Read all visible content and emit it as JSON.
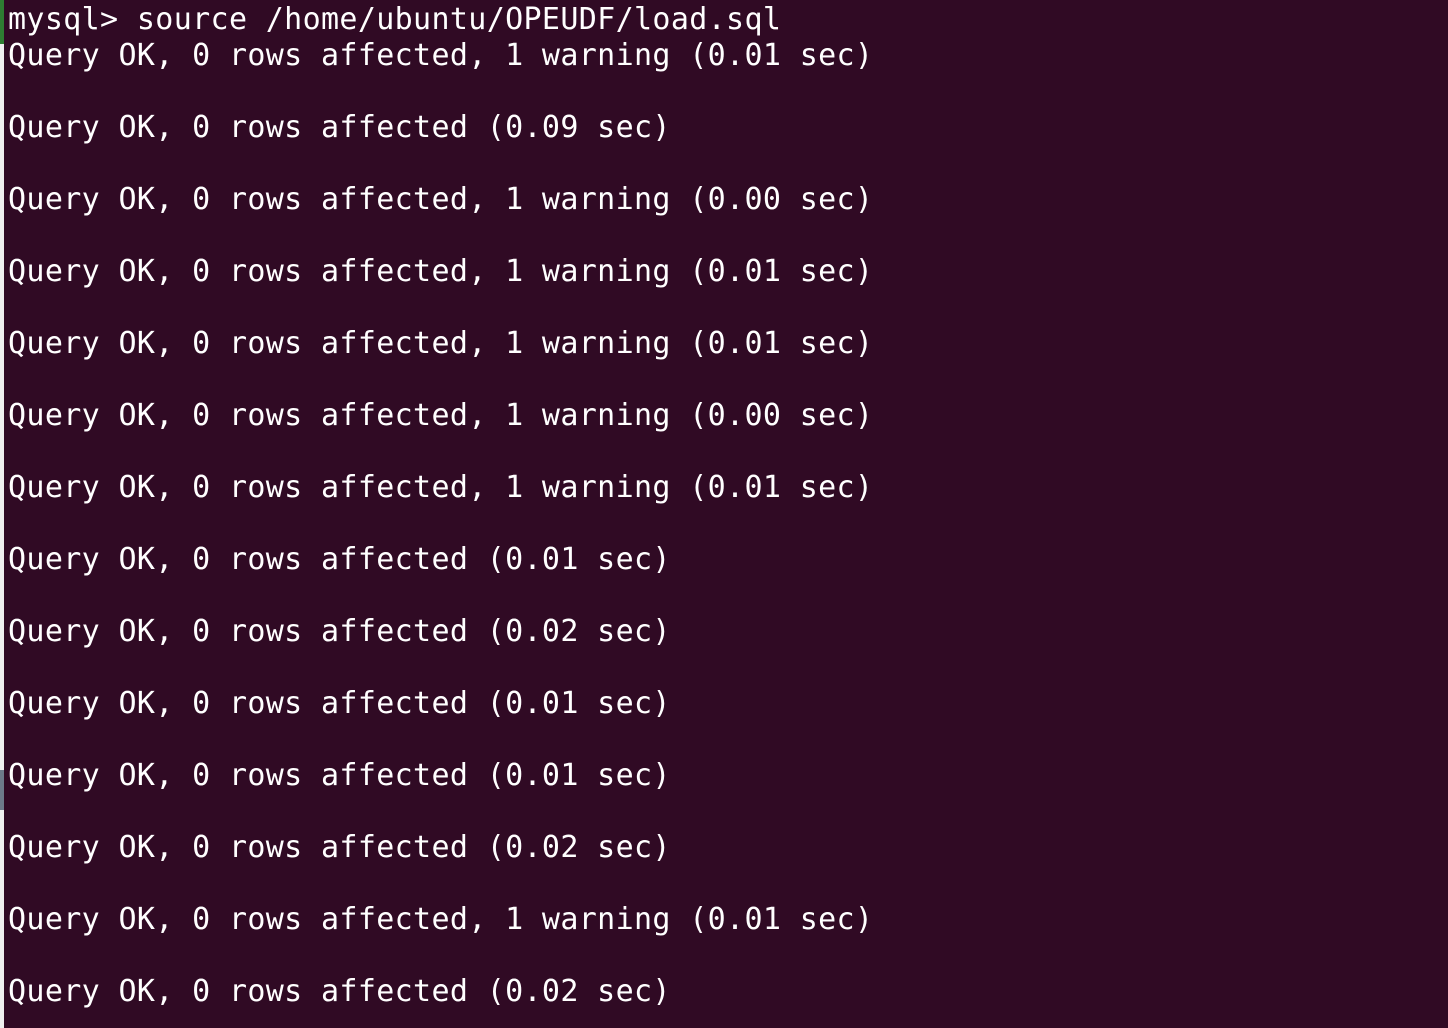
{
  "terminal": {
    "colors": {
      "background": "#300a24",
      "foreground": "#ffffff"
    },
    "prompt_line": "mysql> source /home/ubuntu/OPEUDF/load.sql",
    "output": [
      "Query OK, 0 rows affected, 1 warning (0.01 sec)",
      "Query OK, 0 rows affected (0.09 sec)",
      "Query OK, 0 rows affected, 1 warning (0.00 sec)",
      "Query OK, 0 rows affected, 1 warning (0.01 sec)",
      "Query OK, 0 rows affected, 1 warning (0.01 sec)",
      "Query OK, 0 rows affected, 1 warning (0.00 sec)",
      "Query OK, 0 rows affected, 1 warning (0.01 sec)",
      "Query OK, 0 rows affected (0.01 sec)",
      "Query OK, 0 rows affected (0.02 sec)",
      "Query OK, 0 rows affected (0.01 sec)",
      "Query OK, 0 rows affected (0.01 sec)",
      "Query OK, 0 rows affected (0.02 sec)",
      "Query OK, 0 rows affected, 1 warning (0.01 sec)",
      "Query OK, 0 rows affected (0.02 sec)"
    ]
  }
}
